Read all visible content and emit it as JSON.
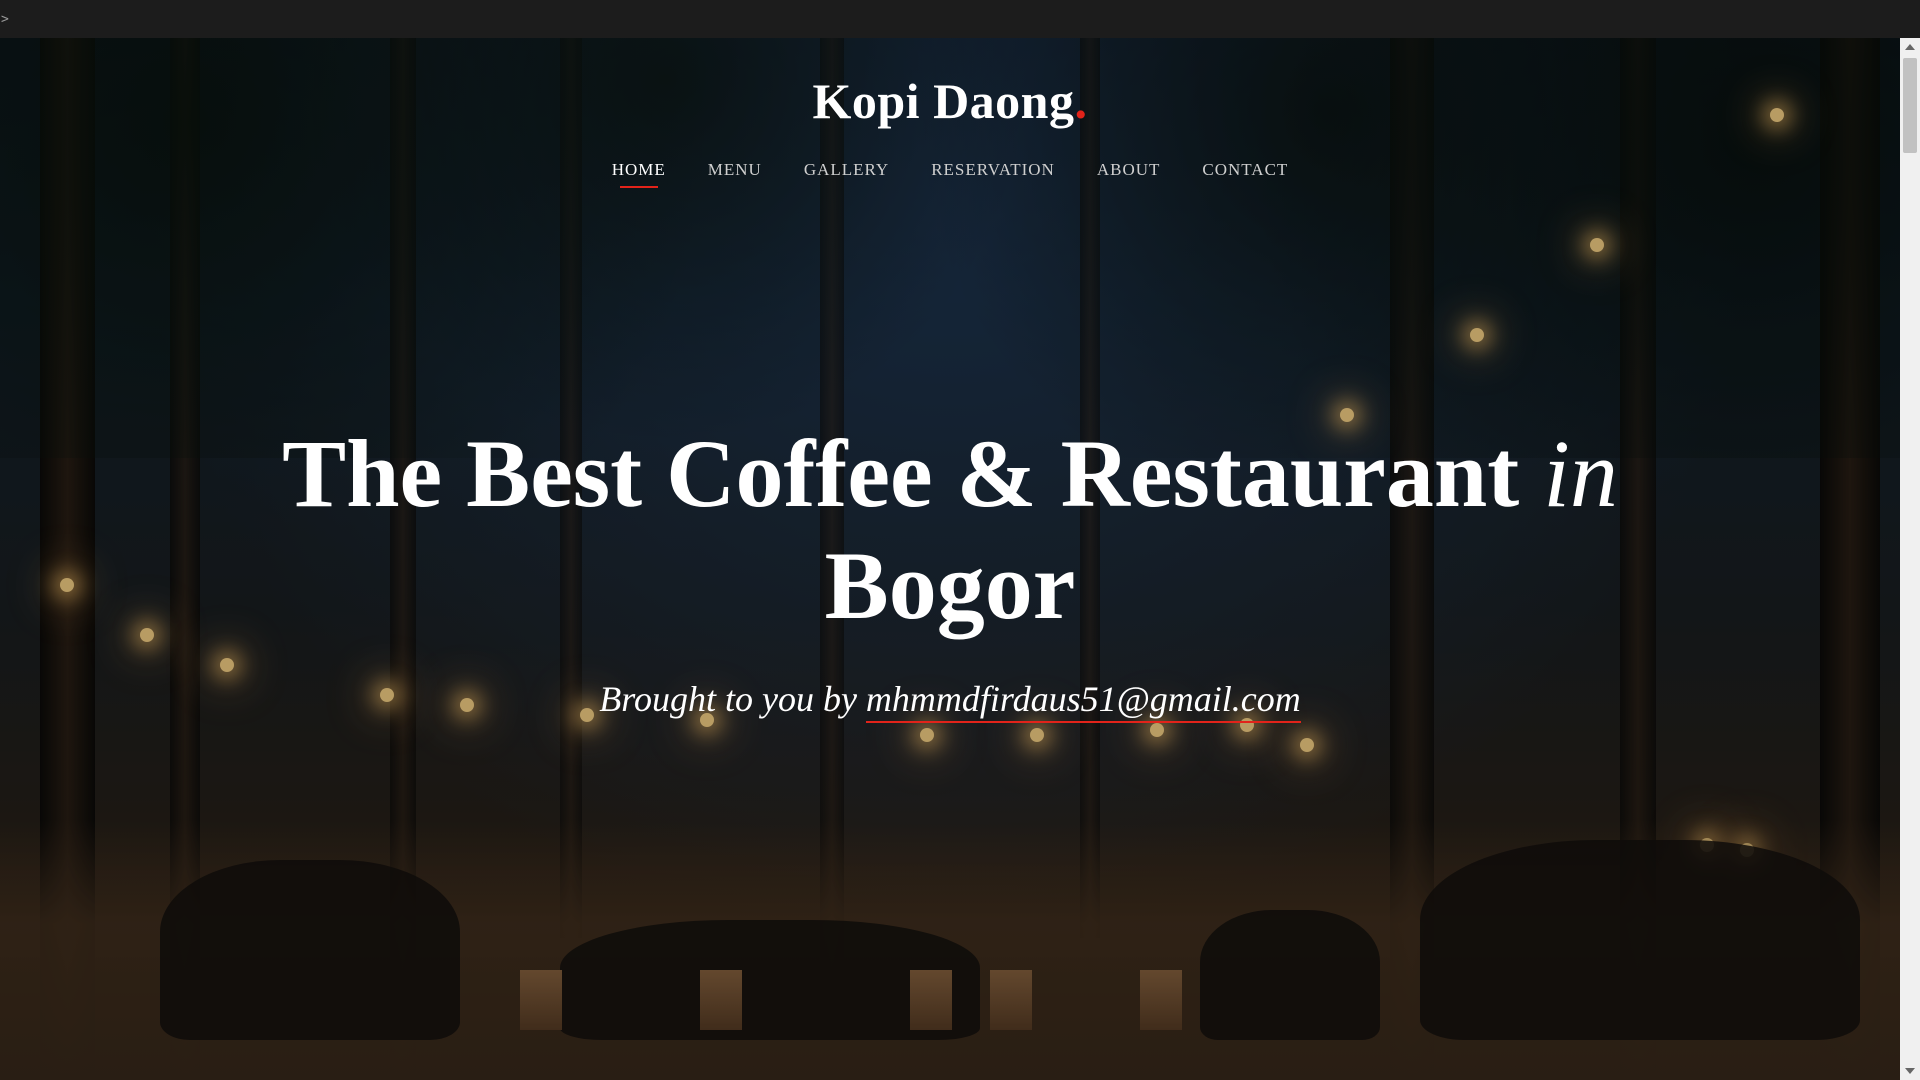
{
  "topbar": {
    "caret": ">"
  },
  "brand": {
    "name": "Kopi Daong",
    "dot": ".",
    "accent_color": "#e2231a"
  },
  "nav": {
    "items": [
      {
        "label": "HOME",
        "active": true
      },
      {
        "label": "MENU",
        "active": false
      },
      {
        "label": "GALLERY",
        "active": false
      },
      {
        "label": "RESERVATION",
        "active": false
      },
      {
        "label": "ABOUT",
        "active": false
      },
      {
        "label": "CONTACT",
        "active": false
      }
    ]
  },
  "hero": {
    "headline_main": "The Best Coffee & Restaurant ",
    "headline_italic": "in",
    "headline_city": "Bogor",
    "sub_prefix": "Brought to you by ",
    "sub_link": "mhmmdfirdaus51@gmail.com",
    "background_image": "outdoor-forest-cafe-string-lights"
  }
}
